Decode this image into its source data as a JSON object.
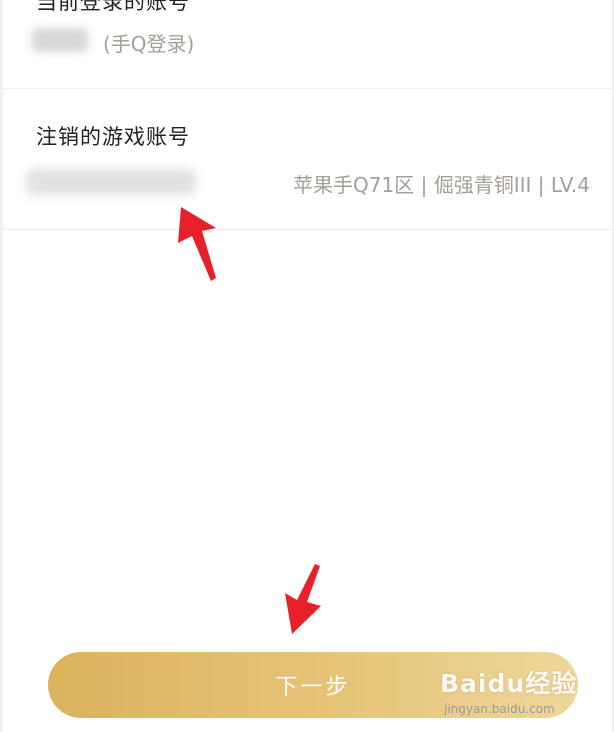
{
  "current_account": {
    "title": "当前登录的账号",
    "login_method": "(手Q登录)"
  },
  "cancel_account": {
    "title": "注销的游戏账号",
    "detail": "苹果手Q71区 | 倔强青铜III | LV.4"
  },
  "actions": {
    "next_label": "下一步"
  },
  "watermark": {
    "logo_text": "Baidu经验",
    "url": "jingyan.baidu.com"
  },
  "colors": {
    "accent_gold": "#dcb35d",
    "annotation_red": "#e8202a",
    "muted_text": "#a59f97"
  }
}
